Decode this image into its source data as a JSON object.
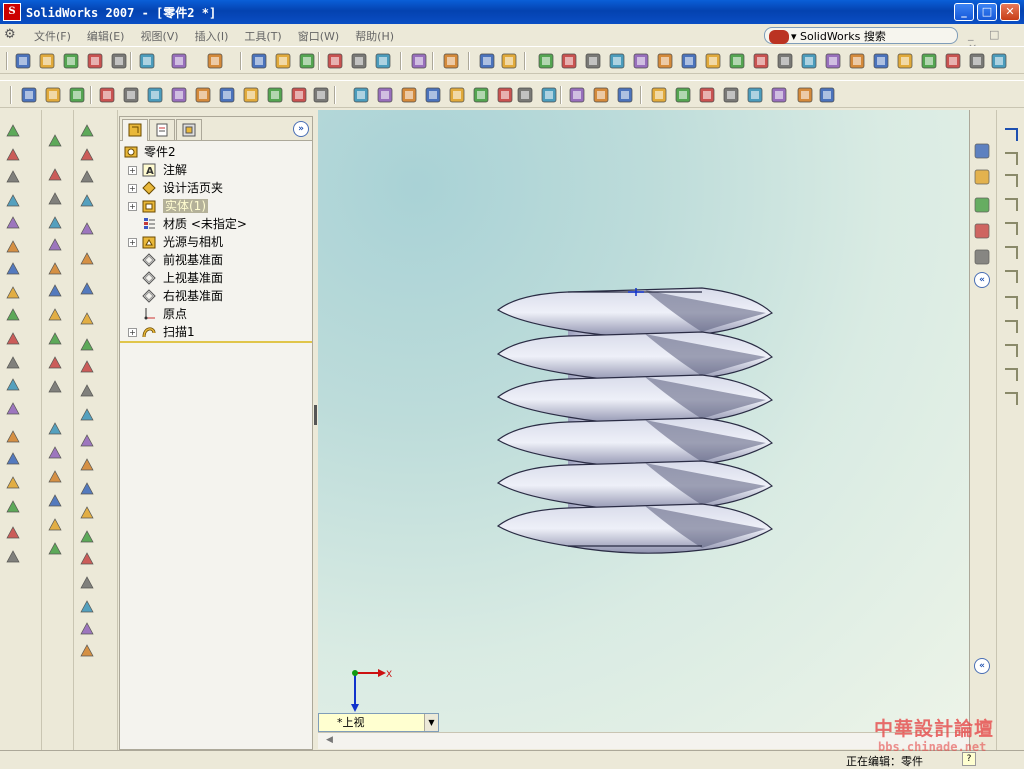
{
  "window": {
    "app_icon_text": "S",
    "title": "SolidWorks 2007 - [零件2 *]",
    "controls": [
      "_",
      "□",
      "✕"
    ]
  },
  "menu": {
    "items": [
      "文件(F)",
      "编辑(E)",
      "视图(V)",
      "插入(I)",
      "工具(T)",
      "窗口(W)",
      "帮助(H)"
    ],
    "search_label": "▾ SolidWorks 搜索",
    "mdi_controls": "_ □ ×"
  },
  "feature_manager": {
    "collapse_glyph": "»",
    "tree": [
      {
        "label": "零件2",
        "icon": "part-icon",
        "expandable": false,
        "root": true
      },
      {
        "label": "注解",
        "icon": "annotations-icon",
        "expandable": true
      },
      {
        "label": "设计活页夹",
        "icon": "design-binder-icon",
        "expandable": true
      },
      {
        "label": "实体(1)",
        "icon": "solid-bodies-icon",
        "expandable": true,
        "highlight": true
      },
      {
        "label": "材质 <未指定>",
        "icon": "material-icon",
        "expandable": false
      },
      {
        "label": "光源与相机",
        "icon": "lights-cameras-icon",
        "expandable": true
      },
      {
        "label": "前视基准面",
        "icon": "plane-icon",
        "expandable": false
      },
      {
        "label": "上视基准面",
        "icon": "plane-icon",
        "expandable": false
      },
      {
        "label": "右视基准面",
        "icon": "plane-icon",
        "expandable": false
      },
      {
        "label": "原点",
        "icon": "origin-icon",
        "expandable": false
      },
      {
        "label": "扫描1",
        "icon": "sweep-icon",
        "expandable": true
      }
    ]
  },
  "viewport": {
    "view_name": "*上视",
    "triad_x": "X",
    "triad_z": "Z"
  },
  "task_pane": {
    "collapse_glyph": "«"
  },
  "status": {
    "editing": "正在编辑：零件",
    "help": "?"
  },
  "watermark": {
    "title": "中華設計論壇",
    "url": "bbs.chinade.net"
  },
  "colors": {
    "accent_blue": "#0a5fd8",
    "body_shade": "#c4c7dc",
    "highlight_bg": "#b4b199"
  }
}
